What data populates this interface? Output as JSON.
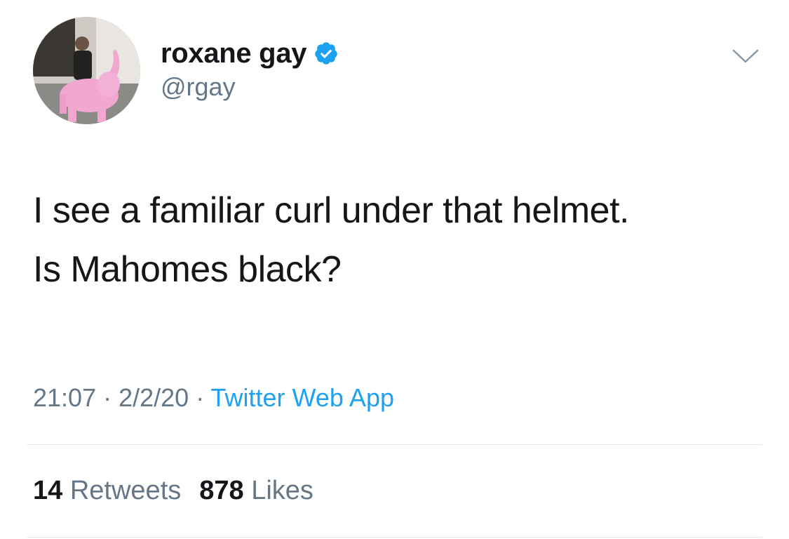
{
  "author": {
    "name": "roxane gay",
    "handle": "@rgay",
    "verified": true
  },
  "tweet": {
    "line1": "I see a familiar curl under that helmet.",
    "line2": "Is Mahomes black?"
  },
  "meta": {
    "time": "21:07",
    "separator": " · ",
    "date": "2/2/20",
    "source": "Twitter Web App"
  },
  "stats": {
    "retweets_count": "14",
    "retweets_label": "Retweets",
    "likes_count": "878",
    "likes_label": "Likes"
  },
  "colors": {
    "link": "#1da1f2",
    "muted": "#657786",
    "text": "#14171a",
    "divider": "#e1e8ed"
  },
  "icons": {
    "verified": "verified-badge-icon",
    "menu": "chevron-down-icon"
  }
}
